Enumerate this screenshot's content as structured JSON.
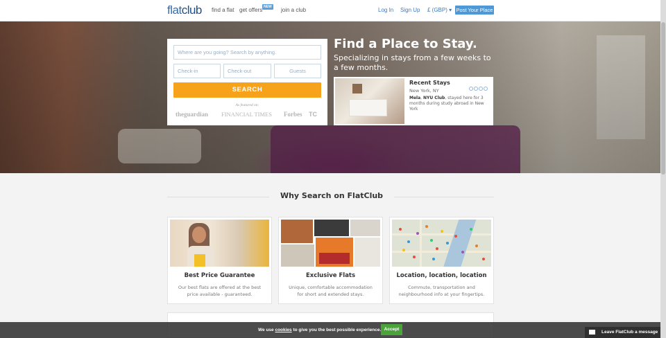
{
  "header": {
    "logo_light": "flat",
    "logo_bold": "club",
    "nav": [
      "find a flat",
      "get offers",
      "join a club"
    ],
    "new_badge": "NEW",
    "login": "Log In",
    "signup": "Sign Up",
    "currency": "£ (GBP) ▾",
    "post_button": "Post Your Place"
  },
  "search": {
    "where_placeholder": "Where are you going? Search by anything.",
    "checkin_placeholder": "Check-in",
    "checkout_placeholder": "Check-out",
    "guests_placeholder": "Guests",
    "button": "SEARCH",
    "featured": "As featured on:",
    "press": [
      "theguardian",
      "FINANCIAL TIMES",
      "Forbes",
      "TC"
    ]
  },
  "hero": {
    "title": "Find a Place to Stay.",
    "subtitle": "Specializing in stays from a few weeks to a few months."
  },
  "recent_stays": {
    "title": "Recent Stays",
    "location": "New York, NY",
    "person": "Mela",
    "club": "NYU Club",
    "text": ", stayed here for 3 months during study abroad in New York"
  },
  "why": {
    "title": "Why Search on FlatClub",
    "features": [
      {
        "title": "Best Price Guarantee",
        "desc": "Our best flats are offered at the best price available - guaranteed."
      },
      {
        "title": "Exclusive Flats",
        "desc": "Unique, comfortable accommodation for short and extended stays."
      },
      {
        "title": "Location, location, location",
        "desc": "Commute, transportation and neighbourhood info at your fingertips."
      }
    ]
  },
  "cookie": {
    "prefix": "We use ",
    "link": "cookies",
    "suffix": " to give you the best possible experience.",
    "accept": "Accept"
  },
  "chat": {
    "label": "Leave FlatClub a message",
    "icon": "envelope-icon"
  },
  "colors": {
    "brand": "#2a6fb8",
    "search_button": "#f6a31b",
    "accept": "#4aa43a"
  }
}
